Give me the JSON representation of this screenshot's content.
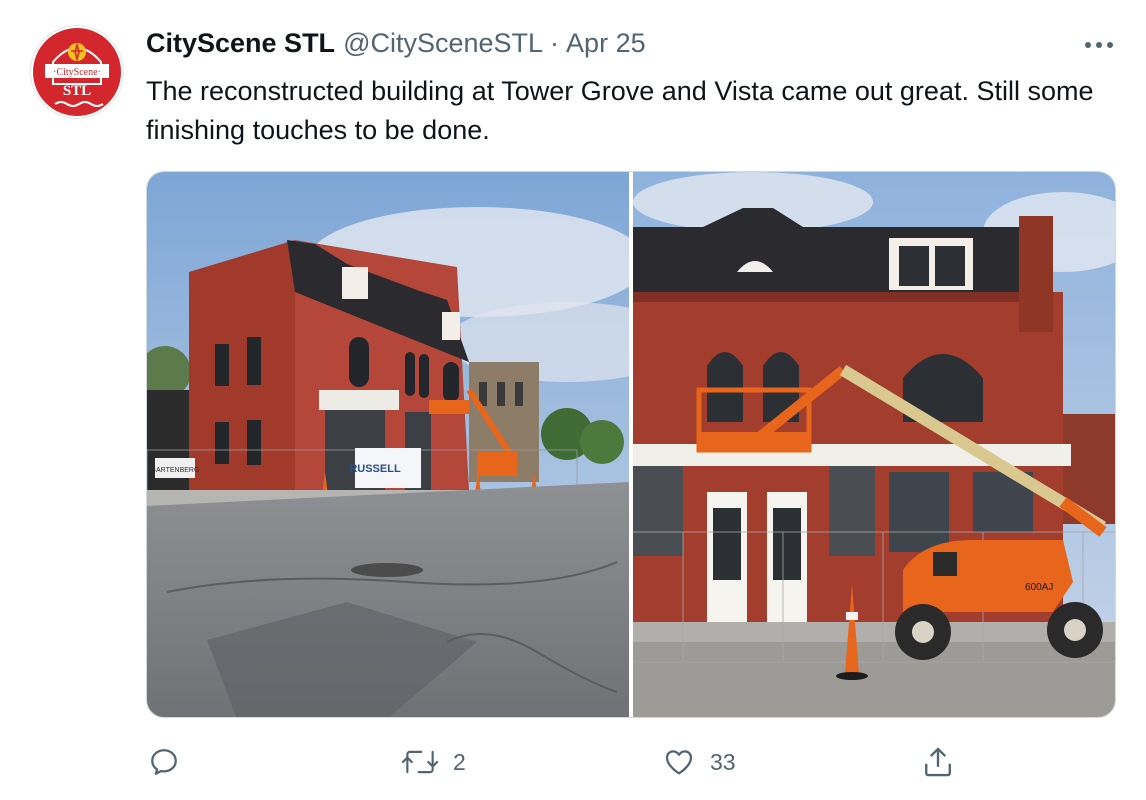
{
  "tweet": {
    "author_name": "CityScene STL",
    "handle": "@CitySceneSTL",
    "separator": "·",
    "date": "Apr 25",
    "text": "The reconstructed building at Tower Grove and Vista came out great. Still some finishing touches to be done.",
    "avatar_text_top": "·CityScene·",
    "avatar_text_bottom": "STL",
    "photo_left_signs": {
      "sign1": "GARTENBERG",
      "sign2": "RUSSELL"
    },
    "photo_right_lift_label": "600AJ"
  },
  "actions": {
    "reply_icon": "reply-icon",
    "retweet_icon": "retweet-icon",
    "retweet_count": "2",
    "like_icon": "heart-icon",
    "like_count": "33",
    "share_icon": "share-icon"
  },
  "colors": {
    "brand_red": "#d4262d",
    "muted_text": "#536471",
    "brick": "#a23a2c",
    "sky": "#9ebde0",
    "lift_orange": "#e8661b"
  }
}
